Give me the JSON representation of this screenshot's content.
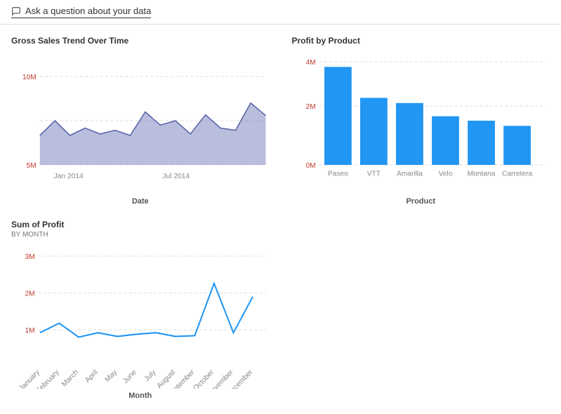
{
  "header": {
    "ask_label": "Ask a question about your data"
  },
  "gross_sales": {
    "title": "Gross Sales Trend Over Time",
    "x_label": "Date",
    "x_ticks": [
      "Jan 2014",
      "Jul 2014"
    ],
    "y_ticks": [
      "10M",
      "5M"
    ],
    "data_points": [
      {
        "x": 0,
        "y": 0.55
      },
      {
        "x": 0.06,
        "y": 0.75
      },
      {
        "x": 0.12,
        "y": 0.55
      },
      {
        "x": 0.18,
        "y": 0.65
      },
      {
        "x": 0.24,
        "y": 0.57
      },
      {
        "x": 0.3,
        "y": 0.62
      },
      {
        "x": 0.36,
        "y": 0.52
      },
      {
        "x": 0.42,
        "y": 0.55
      },
      {
        "x": 0.48,
        "y": 0.9
      },
      {
        "x": 0.54,
        "y": 0.72
      },
      {
        "x": 0.6,
        "y": 0.75
      },
      {
        "x": 0.66,
        "y": 0.57
      },
      {
        "x": 0.72,
        "y": 0.85
      },
      {
        "x": 0.78,
        "y": 0.68
      },
      {
        "x": 0.84,
        "y": 0.65
      },
      {
        "x": 0.9,
        "y": 0.95
      },
      {
        "x": 0.96,
        "y": 0.75
      },
      {
        "x": 1.0,
        "y": 0.88
      }
    ]
  },
  "profit_by_product": {
    "title": "Profit by Product",
    "x_label": "Product",
    "y_ticks": [
      "4M",
      "2M",
      "0M"
    ],
    "products": [
      {
        "name": "Paseo",
        "value": 0.95
      },
      {
        "name": "VTT",
        "value": 0.65
      },
      {
        "name": "Amarilla",
        "value": 0.6
      },
      {
        "name": "Velo",
        "value": 0.47
      },
      {
        "name": "Montana",
        "value": 0.43
      },
      {
        "name": "Carretera",
        "value": 0.38
      }
    ]
  },
  "sum_of_profit": {
    "title": "Sum of Profit",
    "subtitle": "BY MONTH",
    "x_label": "Month",
    "y_ticks": [
      "3M",
      "2M",
      "1M"
    ],
    "months": [
      "January",
      "February",
      "March",
      "April",
      "May",
      "June",
      "July",
      "August",
      "September",
      "October",
      "November",
      "December"
    ],
    "data_points": [
      {
        "x": 0,
        "y": 0.27
      },
      {
        "x": 0.09,
        "y": 0.38
      },
      {
        "x": 0.18,
        "y": 0.22
      },
      {
        "x": 0.27,
        "y": 0.28
      },
      {
        "x": 0.36,
        "y": 0.23
      },
      {
        "x": 0.45,
        "y": 0.26
      },
      {
        "x": 0.54,
        "y": 0.27
      },
      {
        "x": 0.63,
        "y": 0.23
      },
      {
        "x": 0.72,
        "y": 0.24
      },
      {
        "x": 0.81,
        "y": 0.88
      },
      {
        "x": 0.9,
        "y": 0.28
      },
      {
        "x": 1.0,
        "y": 0.73
      }
    ]
  }
}
